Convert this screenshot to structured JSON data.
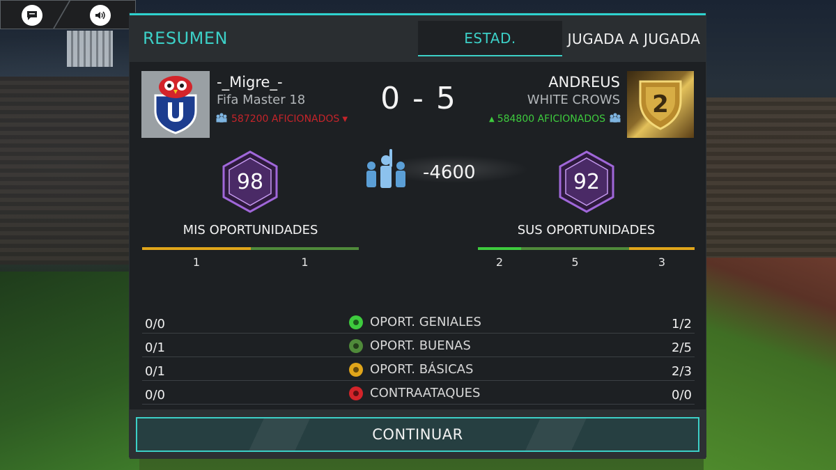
{
  "toolbar": {
    "chat_icon": "chat-bubble-icon",
    "sound_icon": "speaker-icon"
  },
  "header": {
    "title": "RESUMEN",
    "tabs": [
      {
        "label": "ESTAD.",
        "active": true
      },
      {
        "label": "JUGADA A JUGADA",
        "active": false
      }
    ]
  },
  "home": {
    "name": "-_Migre_-",
    "club": "Fifa Master 18",
    "fans": "587200 AFICIONADOS",
    "fans_trend": "down",
    "rating": "98",
    "chances_title": "MIS OPORTUNIDADES",
    "chances_values": [
      "1",
      "1"
    ]
  },
  "away": {
    "name": "ANDREUS",
    "club": "WHITE CROWS",
    "fans": "584800 AFICIONADOS",
    "fans_trend": "up",
    "rating": "92",
    "badge_number": "2",
    "chances_title": "SUS OPORTUNIDADES",
    "chances_values": [
      "2",
      "5",
      "3"
    ]
  },
  "score": "0 - 5",
  "fans_change": "-4600",
  "stats": [
    {
      "home": "0/0",
      "label": "OPORT. GENIALES",
      "away": "1/2",
      "color": "#3ecb3e"
    },
    {
      "home": "0/1",
      "label": "OPORT. BUENAS",
      "away": "2/5",
      "color": "#4f8a3a"
    },
    {
      "home": "0/1",
      "label": "OPORT. BÁSICAS",
      "away": "2/3",
      "color": "#e0a51a"
    },
    {
      "home": "0/0",
      "label": "CONTRAATAQUES",
      "away": "0/0",
      "color": "#d3242a"
    }
  ],
  "continue_label": "CONTINUAR",
  "colors": {
    "accent": "#3cd0c7",
    "bar_yellow": "#e0a51a",
    "bar_green_dark": "#4f8a3a",
    "bar_green_bright": "#3ecb3e",
    "negative": "#c5242a",
    "positive": "#3ecb3e"
  }
}
